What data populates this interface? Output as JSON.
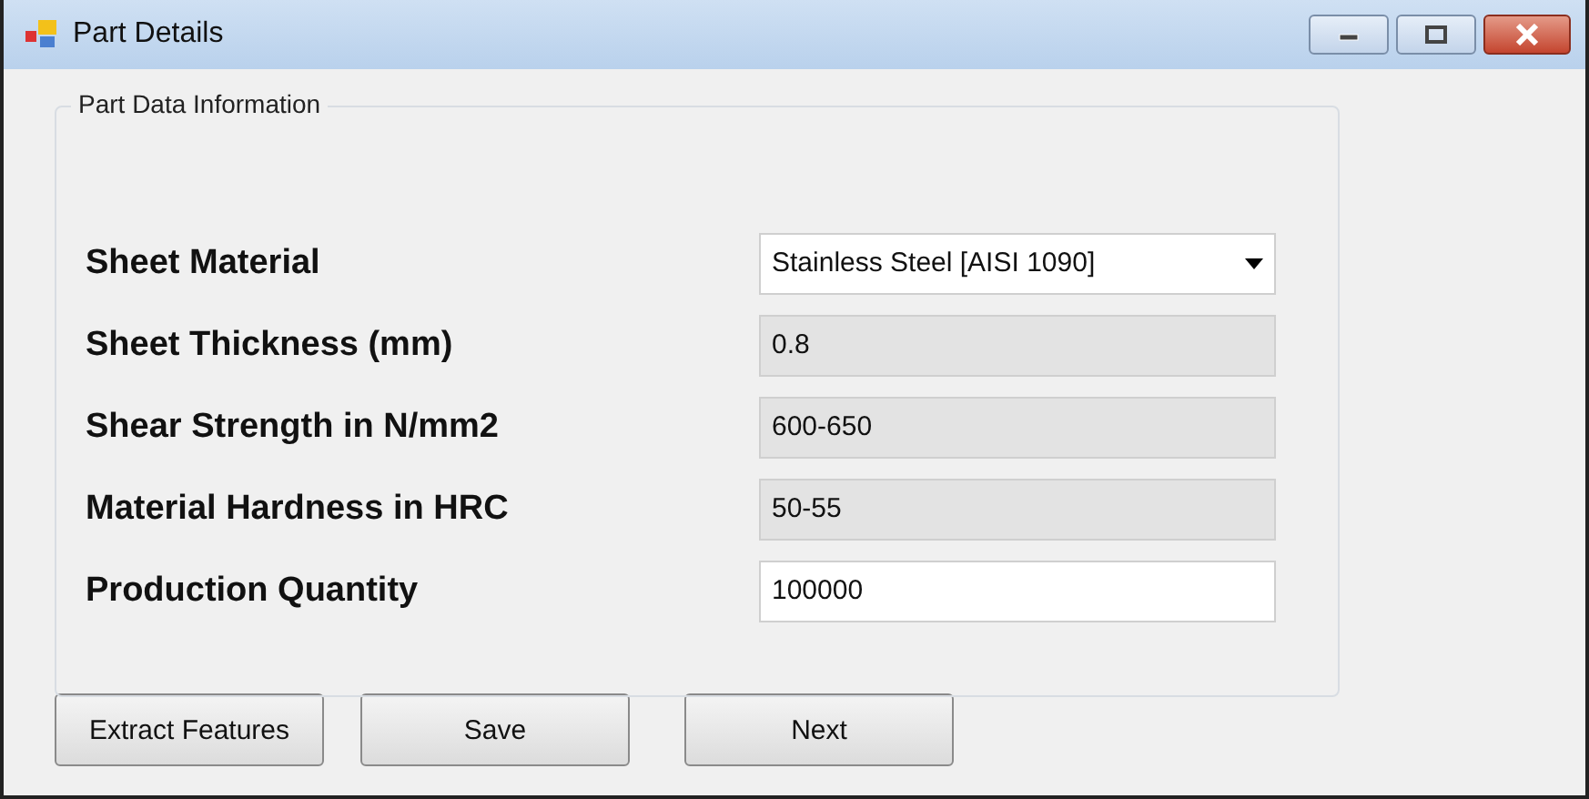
{
  "window": {
    "title": "Part Details"
  },
  "group": {
    "title": "Part Data Information",
    "fields": [
      {
        "label": "Sheet Material",
        "kind": "dropdown",
        "value": "Stainless Steel [AISI 1090]",
        "disabled": false
      },
      {
        "label": "Sheet Thickness (mm)",
        "kind": "text",
        "value": "0.8",
        "disabled": true
      },
      {
        "label": "Shear Strength in N/mm2",
        "kind": "text",
        "value": "600-650",
        "disabled": true
      },
      {
        "label": "Material Hardness in HRC",
        "kind": "text",
        "value": "50-55",
        "disabled": true
      },
      {
        "label": "Production Quantity",
        "kind": "text",
        "value": "100000",
        "disabled": false
      }
    ]
  },
  "buttons": [
    "Extract Features",
    "Save",
    "Next"
  ]
}
